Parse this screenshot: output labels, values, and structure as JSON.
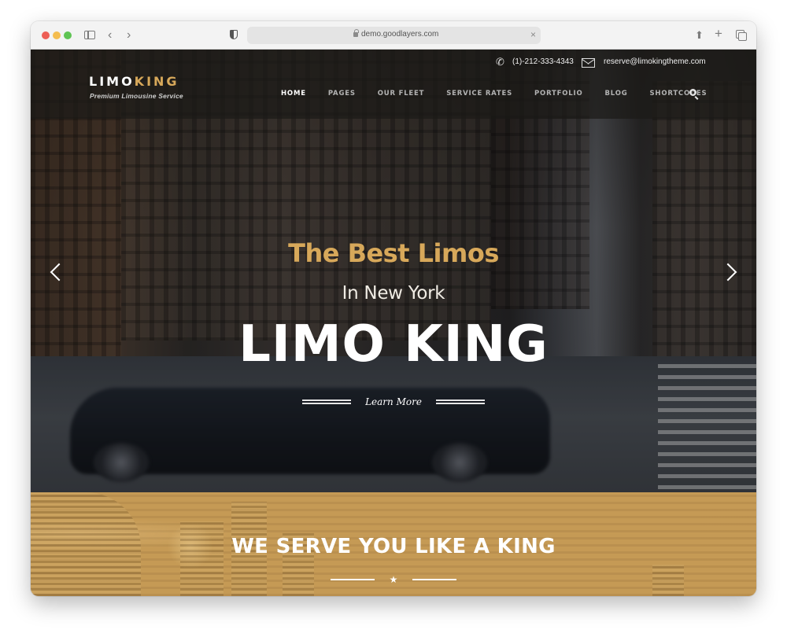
{
  "browser": {
    "url": "demo.goodlayers.com",
    "buttons": [
      "sidebar",
      "back",
      "forward",
      "share",
      "new-tab",
      "tab-overview"
    ]
  },
  "header": {
    "logo_part1": "LIMO",
    "logo_part2": "KING",
    "tagline": "Premium Limousine Service",
    "phone": "(1)-212-333-4343",
    "email": "reserve@limokingtheme.com",
    "nav": [
      {
        "label": "HOME",
        "active": true
      },
      {
        "label": "PAGES",
        "active": false
      },
      {
        "label": "OUR FLEET",
        "active": false
      },
      {
        "label": "SERVICE RATES",
        "active": false
      },
      {
        "label": "PORTFOLIO",
        "active": false
      },
      {
        "label": "BLOG",
        "active": false
      },
      {
        "label": "SHORTCODES",
        "active": false
      }
    ]
  },
  "hero": {
    "title_line1": "The Best Limos",
    "title_line2": "In New York",
    "title_line3": "LIMO KING",
    "cta": "Learn More",
    "slides_total": 3,
    "active_slide": 1,
    "prev_glyph": "‹",
    "next_glyph": "›"
  },
  "serve": {
    "title": "WE SERVE YOU LIKE A KING",
    "star": "★"
  },
  "colors": {
    "accent_gold": "#d7a85a",
    "section_gold": "#c59a55"
  }
}
